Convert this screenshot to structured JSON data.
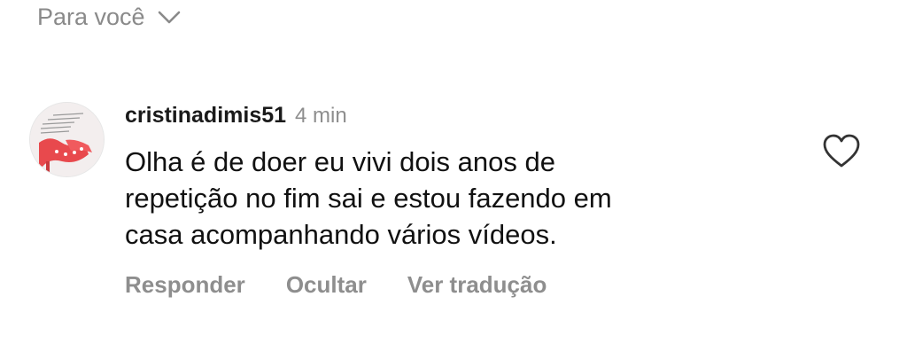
{
  "header": {
    "filter_label": "Para você",
    "filter_icon": "chevron-down-icon"
  },
  "comment": {
    "username": "cristinadimis51",
    "time": "4 min",
    "text": "Olha é de doer eu vivi dois anos de\nrepetição no fim sai e estou fazendo em\ncasa acompanhando vários vídeos.",
    "like_icon": "heart-outline-icon",
    "actions": {
      "reply": "Responder",
      "hide": "Ocultar",
      "translate": "Ver tradução"
    }
  },
  "colors": {
    "muted": "#8e8e8e",
    "text": "#111111",
    "avatar_accent": "#e8494d"
  }
}
